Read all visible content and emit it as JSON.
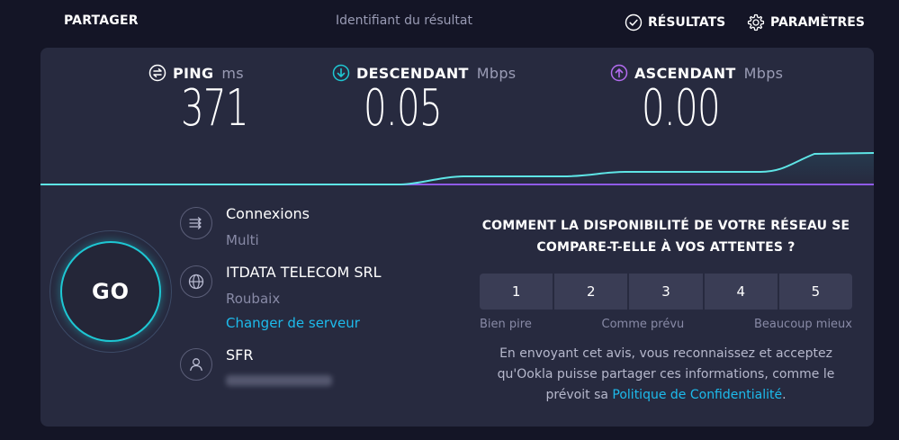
{
  "header": {
    "share_label": "PARTAGER",
    "result_id_label": "Identifiant du résultat",
    "results_label": "RÉSULTATS",
    "results_icon": "check-circle-icon",
    "settings_label": "PARAMÈTRES",
    "settings_icon": "gear-icon"
  },
  "metrics": {
    "ping": {
      "label": "PING",
      "unit": "ms",
      "value": "371",
      "icon": "ping-icon"
    },
    "download": {
      "label": "DESCENDANT",
      "unit": "Mbps",
      "value": "0.05",
      "icon": "download-arrow-icon",
      "color": "#1ec7d3"
    },
    "upload": {
      "label": "ASCENDANT",
      "unit": "Mbps",
      "value": "0.00",
      "icon": "upload-arrow-icon",
      "color": "#9b59ea"
    }
  },
  "graph": {
    "download_color": "#5ee5e6",
    "upload_color": "#8f5be8"
  },
  "go_button": {
    "label": "GO",
    "color": "#1ec7d3"
  },
  "connections": {
    "label": "Connexions",
    "value": "Multi",
    "icon": "connections-icon"
  },
  "server": {
    "provider": "ITDATA TELECOM SRL",
    "location": "Roubaix",
    "change_label": "Changer de serveur",
    "icon": "globe-icon"
  },
  "user": {
    "isp": "SFR",
    "icon": "user-icon"
  },
  "survey": {
    "question": "COMMENT LA DISPONIBILITÉ DE VOTRE RÉSEAU SE COMPARE-T-ELLE À VOS ATTENTES ?",
    "options": [
      "1",
      "2",
      "3",
      "4",
      "5"
    ],
    "scale_low": "Bien pire",
    "scale_mid": "Comme prévu",
    "scale_high": "Beaucoup mieux",
    "disclaimer_before": "En envoyant cet avis, vous reconnaissez et acceptez qu'Ookla puisse partager ces informations, comme le prévoit sa ",
    "privacy_link": "Politique de Confidentialité",
    "disclaimer_after": "."
  }
}
